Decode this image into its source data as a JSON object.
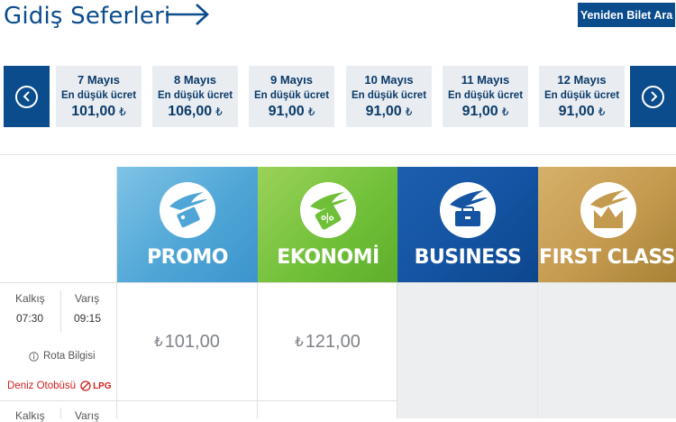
{
  "header": {
    "title": "Gidiş Seferleri",
    "arrow_icon": "long-arrow-right-icon",
    "re_search_label": "Yeniden Bilet Ara"
  },
  "date_strip": {
    "prev_icon": "chevron-left-circle-icon",
    "next_icon": "chevron-right-circle-icon",
    "days": [
      {
        "date": "7 Mayıs",
        "label": "En düşük ücret",
        "price": "101,00",
        "currency": "₺"
      },
      {
        "date": "8 Mayıs",
        "label": "En düşük ücret",
        "price": "106,00",
        "currency": "₺"
      },
      {
        "date": "9 Mayıs",
        "label": "En düşük ücret",
        "price": "91,00",
        "currency": "₺"
      },
      {
        "date": "10 Mayıs",
        "label": "En düşük ücret",
        "price": "91,00",
        "currency": "₺"
      },
      {
        "date": "11 Mayıs",
        "label": "En düşük ücret",
        "price": "91,00",
        "currency": "₺"
      },
      {
        "date": "12 Mayıs",
        "label": "En düşük ücret",
        "price": "91,00",
        "currency": "₺"
      }
    ]
  },
  "fare_classes": [
    {
      "name": "PROMO",
      "icon": "promo-tag-icon",
      "color": "#4fa6d6"
    },
    {
      "name": "EKONOMİ",
      "icon": "discount-percent-icon",
      "color": "#6fbf38"
    },
    {
      "name": "BUSINESS",
      "icon": "briefcase-icon",
      "color": "#1454a3"
    },
    {
      "name": "FIRST CLASS",
      "icon": "crown-icon",
      "color": "#c49a4f"
    }
  ],
  "schedule": {
    "departure_label": "Kalkış",
    "arrival_label": "Varış",
    "departure_time": "07:30",
    "arrival_time": "09:15",
    "route_info": "Rota Bilgisi",
    "vehicle": "Deniz Otobüsü",
    "lpg": "LPG",
    "prices": [
      {
        "currency": "₺",
        "amount": "101,00"
      },
      {
        "currency": "₺",
        "amount": "121,00"
      }
    ]
  },
  "next_schedule": {
    "departure_label": "Kalkış",
    "arrival_label": "Varış"
  }
}
